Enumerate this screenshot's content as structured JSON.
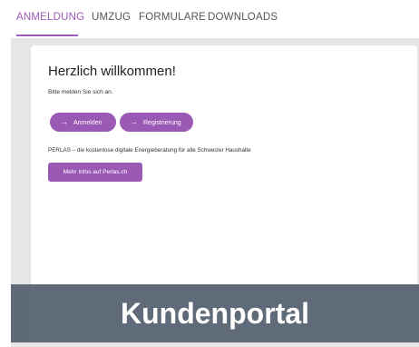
{
  "nav": {
    "tabs": [
      {
        "label": "ANMELDUNG",
        "active": true
      },
      {
        "label": "UMZUG",
        "active": false
      },
      {
        "label": "FORMULARE",
        "active": false
      },
      {
        "label": "DOWNLOADS",
        "active": false
      }
    ]
  },
  "login": {
    "title": "Herzlich willkommen!",
    "subtitle": "Bitte melden Sie sich an.",
    "login_button": "Anmelden",
    "register_button": "Registrierung",
    "arrow": "→"
  },
  "info": {
    "text": "PERLAS – die kostenlose digitale Energieberatung für alle Schweizer Haushalte",
    "button": "Mehr Infos auf Perlas.ch"
  },
  "banner": {
    "text": "Kundenportal"
  },
  "colors": {
    "accent": "#9b59b6",
    "banner_bg": "#546070",
    "page_bg": "#e6e6e6"
  }
}
